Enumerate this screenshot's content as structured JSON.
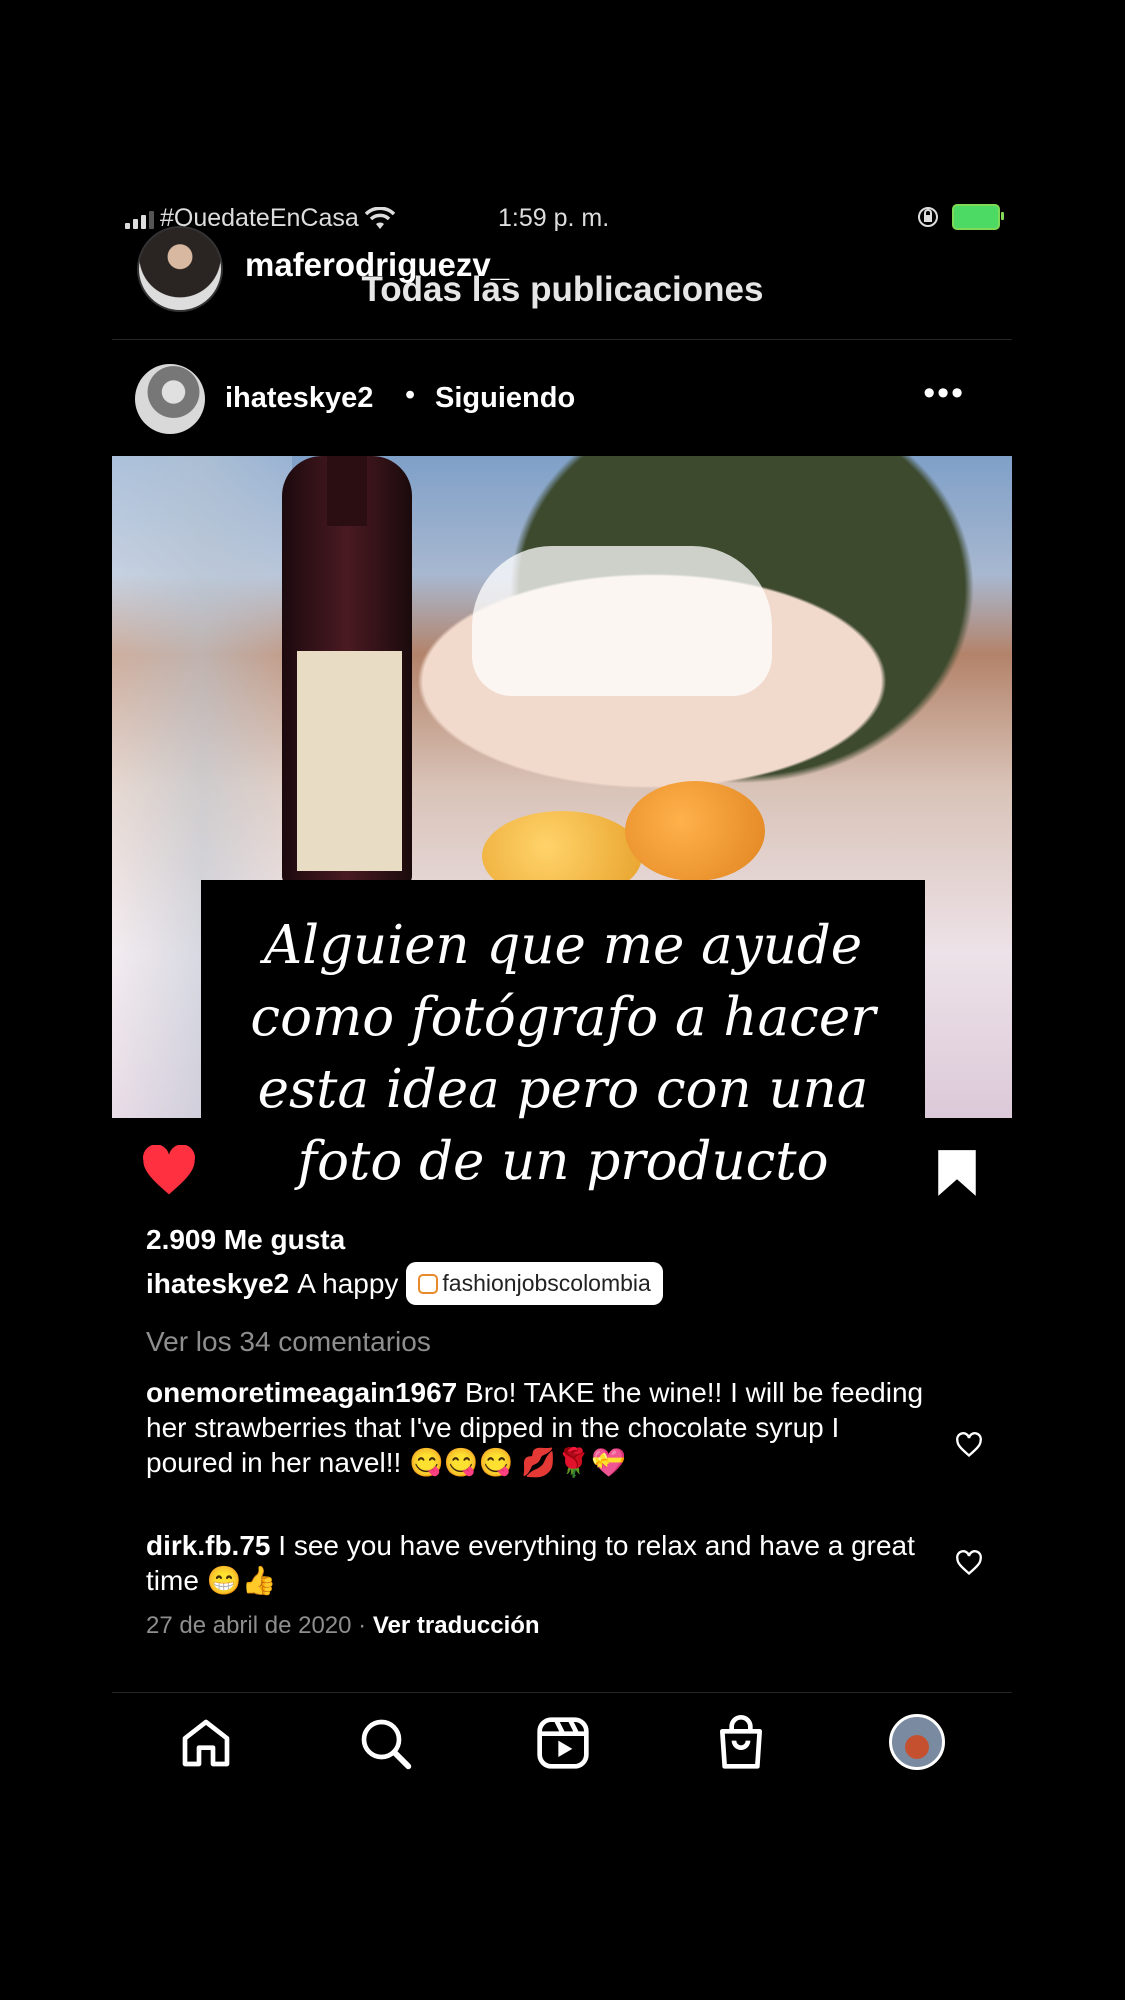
{
  "status_bar": {
    "carrier": "#QuedateEnCasa",
    "time": "1:59 p. m."
  },
  "header": {
    "username": "maferodriguezv_",
    "title": "Todas las publicaciones"
  },
  "post": {
    "username": "ihateskye2",
    "separator": "•",
    "follow_status": "Siguiendo",
    "more_label": "•••",
    "image_caption": "Alguien que me ayude como fotógrafo a hacer esta idea pero con una foto de un producto",
    "likes": "2.909 Me gusta",
    "caption_user": "ihateskye2",
    "caption_text": "A happy",
    "tag": "fashionjobscolombia",
    "view_comments": "Ver los 34 comentarios",
    "comments": [
      {
        "user": "onemoretimeagain1967",
        "text": "Bro! TAKE the wine!! I will be feeding her strawberries that I've dipped in the chocolate syrup I poured in her navel!! 😋😋😋 💋🌹💝"
      },
      {
        "user": "dirk.fb.75",
        "text": "I see you have everything to relax and have a great time 😁👍"
      }
    ],
    "date": "27 de abril de 2020",
    "date_separator": "·",
    "translate": "Ver traducción"
  },
  "colors": {
    "like_red": "#ff3040",
    "muted": "#8e8e8e",
    "background": "#000000"
  },
  "tabbar": {
    "items": [
      "home-icon",
      "search-icon",
      "reels-icon",
      "shop-icon",
      "profile-avatar"
    ]
  }
}
